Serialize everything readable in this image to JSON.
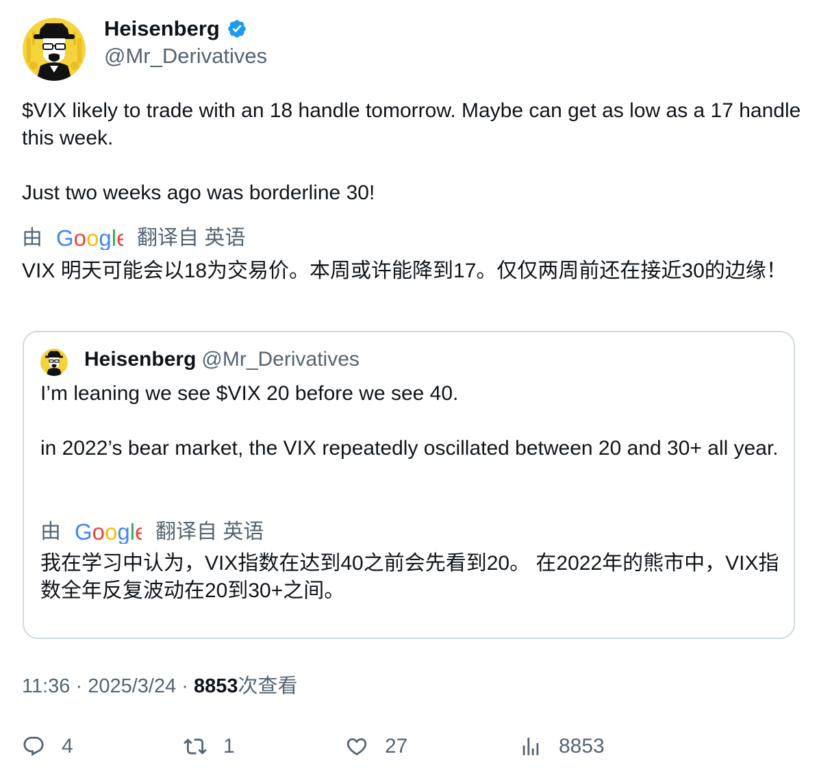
{
  "author": {
    "name": "Heisenberg",
    "handle": "@Mr_Derivatives",
    "verified_color": "#1d9bf0"
  },
  "tweet": {
    "text": "$VIX likely to trade with an 18 handle tomorrow. Maybe can get as low as a 17 handle this week.\n\nJust two weeks ago was borderline 30!",
    "translate_prefix": "由",
    "google_logo_text": "Google",
    "translate_suffix": "翻译自 英语",
    "translated_text": "VIX 明天可能会以18为交易价。本周或许能降到17。仅仅两周前还在接近30的边缘！"
  },
  "quoted_tweet": {
    "name": "Heisenberg",
    "handle": "@Mr_Derivatives",
    "text": "I’m leaning we see $VIX 20 before we see 40.\n\nin 2022’s bear market, the VIX repeatedly oscillated between 20 and 30+ all year.",
    "translate_prefix": "由",
    "google_logo_text": "Google",
    "translate_suffix": "翻译自 英语",
    "translated_text": "我在学习中认为，VIX指数在达到40之前会先看到20。 在2022年的熊市中，VIX指数全年反复波动在20到30+之间。"
  },
  "meta": {
    "time": "11:36",
    "separator": "·",
    "date": "2025/3/24",
    "views_count": "8853",
    "views_label": "次查看"
  },
  "actions": {
    "replies": "4",
    "retweets": "1",
    "likes": "27",
    "views": "8853"
  }
}
